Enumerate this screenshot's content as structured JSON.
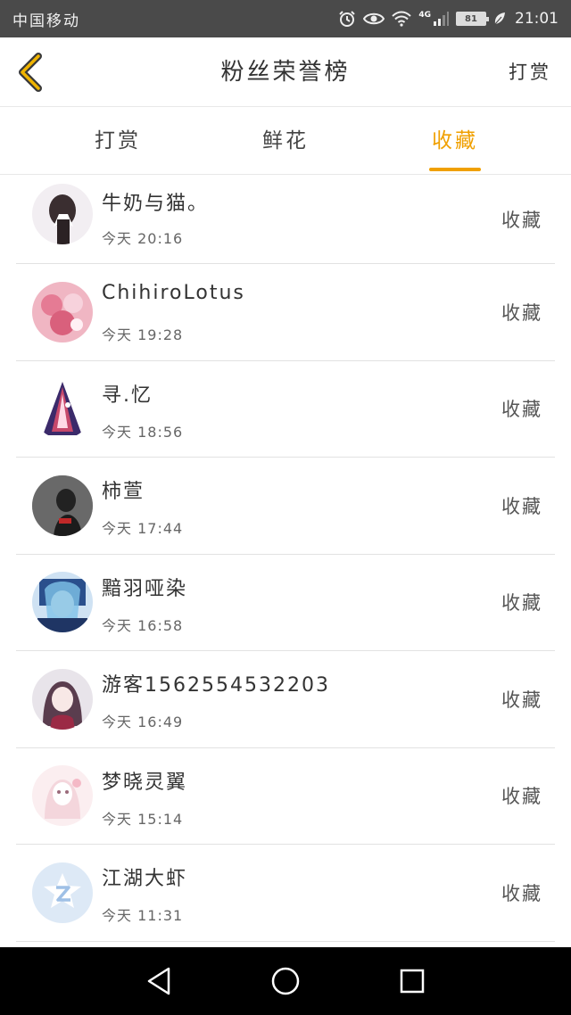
{
  "status": {
    "carrier": "中国移动",
    "network": "4G",
    "battery": "81",
    "time": "21:01"
  },
  "header": {
    "title": "粉丝荣誉榜",
    "right_action": "打赏"
  },
  "tabs": [
    {
      "label": "打赏",
      "active": false
    },
    {
      "label": "鲜花",
      "active": false
    },
    {
      "label": "收藏",
      "active": true
    }
  ],
  "colors": {
    "accent": "#f0a000",
    "status_bar": "#4a4a4a",
    "nav_bar": "#000000"
  },
  "list": [
    {
      "name": "牛奶与猫。",
      "time": "今天 20:16",
      "action": "收藏"
    },
    {
      "name": "ChihiroLotus",
      "time": "今天 19:28",
      "action": "收藏"
    },
    {
      "name": "寻.忆",
      "time": "今天 18:56",
      "action": "收藏"
    },
    {
      "name": "柿萱",
      "time": "今天 17:44",
      "action": "收藏"
    },
    {
      "name": "黯羽哑染",
      "time": "今天 16:58",
      "action": "收藏"
    },
    {
      "name": "游客1562554532203",
      "time": "今天 16:49",
      "action": "收藏"
    },
    {
      "name": "梦晓灵翼",
      "time": "今天 15:14",
      "action": "收藏"
    },
    {
      "name": "江湖大虾",
      "time": "今天 11:31",
      "action": "收藏"
    }
  ],
  "nav": {
    "back_icon": "triangle-back-icon",
    "home_icon": "circle-home-icon",
    "recents_icon": "square-recents-icon"
  }
}
